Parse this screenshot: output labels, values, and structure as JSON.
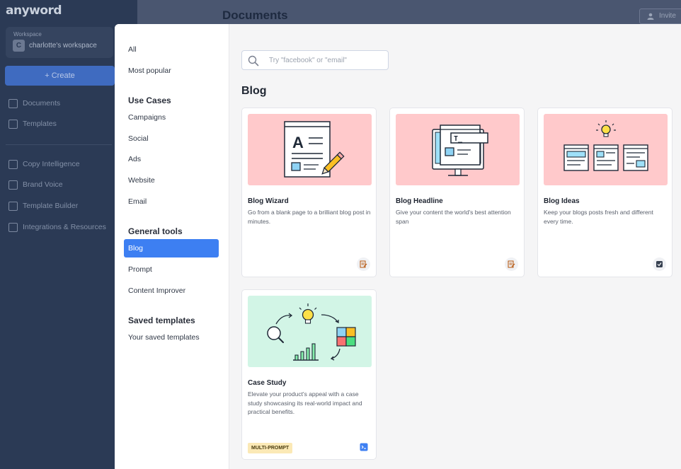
{
  "app": {
    "logo": "anyword",
    "workspace": {
      "label": "Workspace",
      "avatar_letter": "C",
      "name": "charlotte's workspace"
    },
    "create_label": "+ Create",
    "nav": [
      {
        "label": "Documents",
        "icon": "documents-icon"
      },
      {
        "label": "Templates",
        "icon": "templates-icon"
      },
      {
        "label": "Copy Intelligence",
        "icon": "analytics-icon"
      },
      {
        "label": "Brand Voice",
        "icon": "megaphone-icon"
      },
      {
        "label": "Template Builder",
        "icon": "builder-icon"
      },
      {
        "label": "Integrations & Resources",
        "icon": "grid-icon"
      }
    ],
    "page_title": "Documents",
    "invite_label": "Invite"
  },
  "modal": {
    "nav": {
      "all": "All",
      "most_popular": "Most popular",
      "use_cases_heading": "Use Cases",
      "use_cases": [
        "Campaigns",
        "Social",
        "Ads",
        "Website",
        "Email"
      ],
      "general_tools_heading": "General tools",
      "general_tools": [
        "Blog",
        "Prompt",
        "Content Improver"
      ],
      "active_item": "Blog",
      "saved_heading": "Saved templates",
      "saved_item": "Your saved templates"
    },
    "search": {
      "placeholder": "Try \"facebook\" or \"email\"",
      "value": ""
    },
    "section_title": "Blog",
    "cards": [
      {
        "title": "Blog Wizard",
        "description": "Go from a blank page to a brilliant blog post in minutes.",
        "thumb_color": "#ffc9cb",
        "tool_icon": "edit-doc-icon"
      },
      {
        "title": "Blog Headline",
        "description": "Give your content the world's best attention span",
        "thumb_color": "#ffc9cb",
        "tool_icon": "edit-doc-icon"
      },
      {
        "title": "Blog Ideas",
        "description": "Keep your blogs posts fresh and different every time.",
        "thumb_color": "#ffc9cb",
        "tool_icon": "checklist-icon"
      },
      {
        "title": "Case Study",
        "description": "Elevate your product's appeal with a case study showcasing its real-world impact and practical benefits.",
        "thumb_color": "#d2f5e6",
        "tool_icon": "prompt-icon",
        "badge": "MULTI-PROMPT"
      }
    ]
  },
  "colors": {
    "accent": "#3d7ff2",
    "blog_thumb": "#ffc9cb",
    "case_thumb": "#d2f5e6",
    "badge": "#fbe9b6"
  }
}
